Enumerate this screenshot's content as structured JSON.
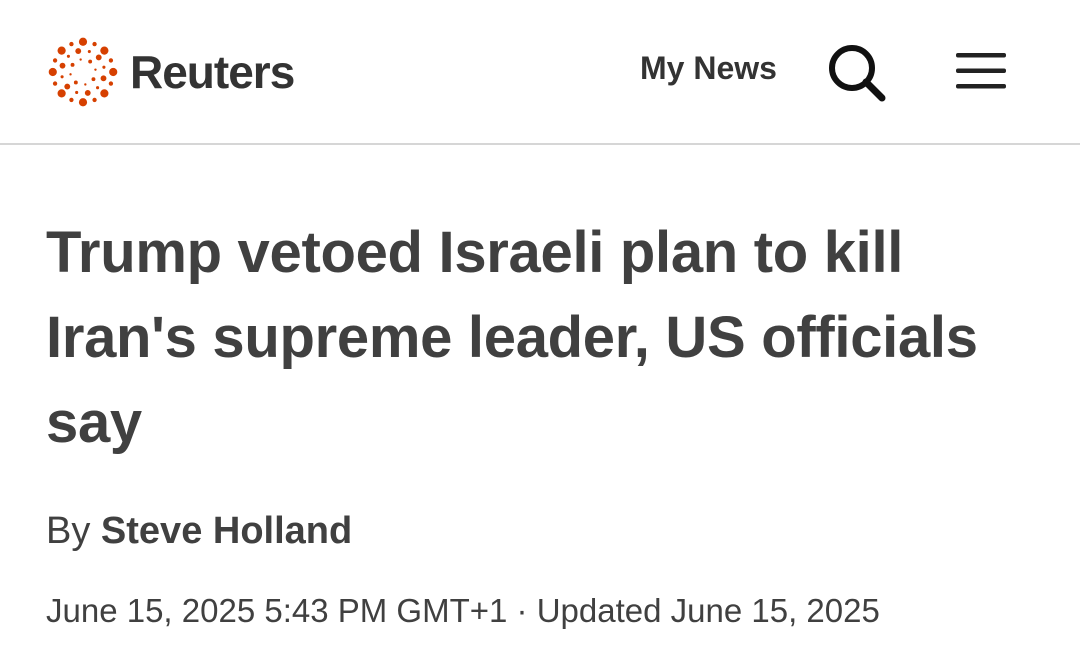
{
  "header": {
    "logo_text": "Reuters",
    "my_news_label": "My News",
    "search_icon": "search-icon",
    "menu_icon": "hamburger-menu-icon",
    "brand_color": "#d64000"
  },
  "article": {
    "headline": "Trump vetoed Israeli plan to kill Iran's supreme leader, US officials say",
    "byline_prefix": "By",
    "author": "Steve Holland",
    "published": "June 15, 2025 5:43 PM GMT+1",
    "separator": "·",
    "updated": "Updated June 15, 2025"
  }
}
